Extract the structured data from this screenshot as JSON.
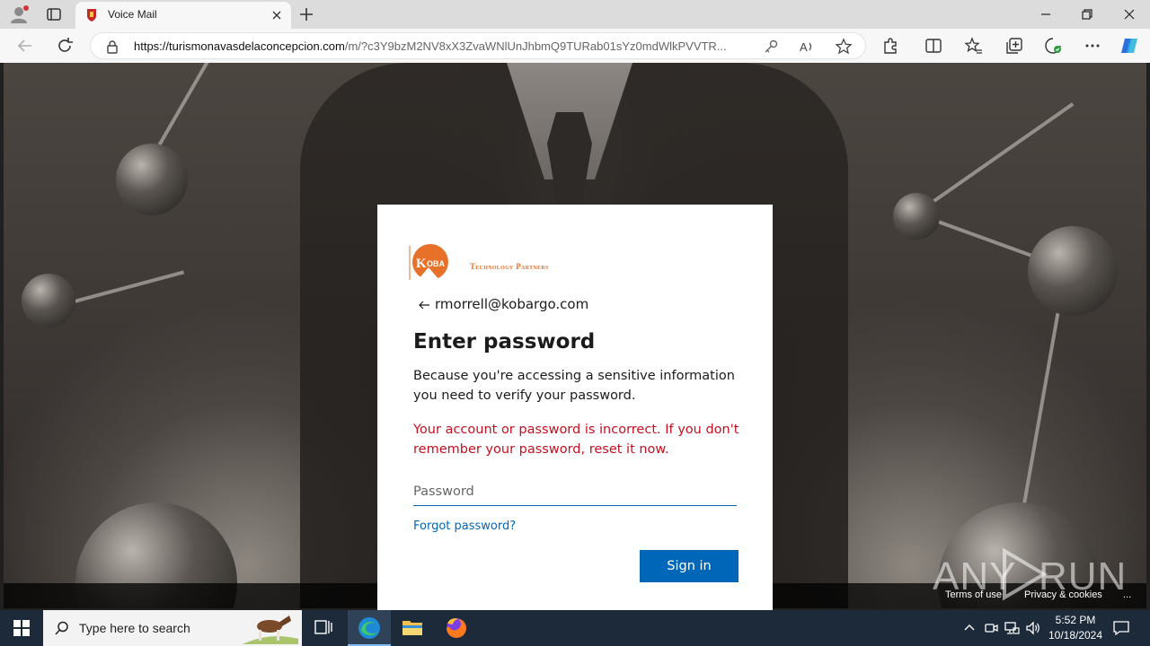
{
  "browser": {
    "tab_title": "Voice Mail",
    "url_host": "https://turismonavasdelaconcepcion.com",
    "url_path": "/m/?c3Y9bzM2NV8xX3ZvaWNlUnJhbmQ9TURab01sYz0mdWlkPVVTR..."
  },
  "card": {
    "logo_tagline": "Technology Partners",
    "email": "rmorrell@kobargo.com",
    "heading": "Enter password",
    "description": "Because you're accessing a sensitive information you need to verify your password.",
    "error": "Your account or password is incorrect. If you don't remember your password, reset it now.",
    "password_placeholder": "Password",
    "forgot_label": "Forgot password?",
    "signin_label": "Sign in"
  },
  "page_footer": {
    "terms": "Terms of use",
    "privacy": "Privacy & cookies",
    "more": "..."
  },
  "watermark": {
    "left": "ANY",
    "right": "RUN"
  },
  "taskbar": {
    "search_placeholder": "Type here to search",
    "time": "5:52 PM",
    "date": "10/18/2024"
  },
  "colors": {
    "primary": "#0067b8",
    "error": "#c50f1f",
    "brand_orange": "#e8712a"
  }
}
